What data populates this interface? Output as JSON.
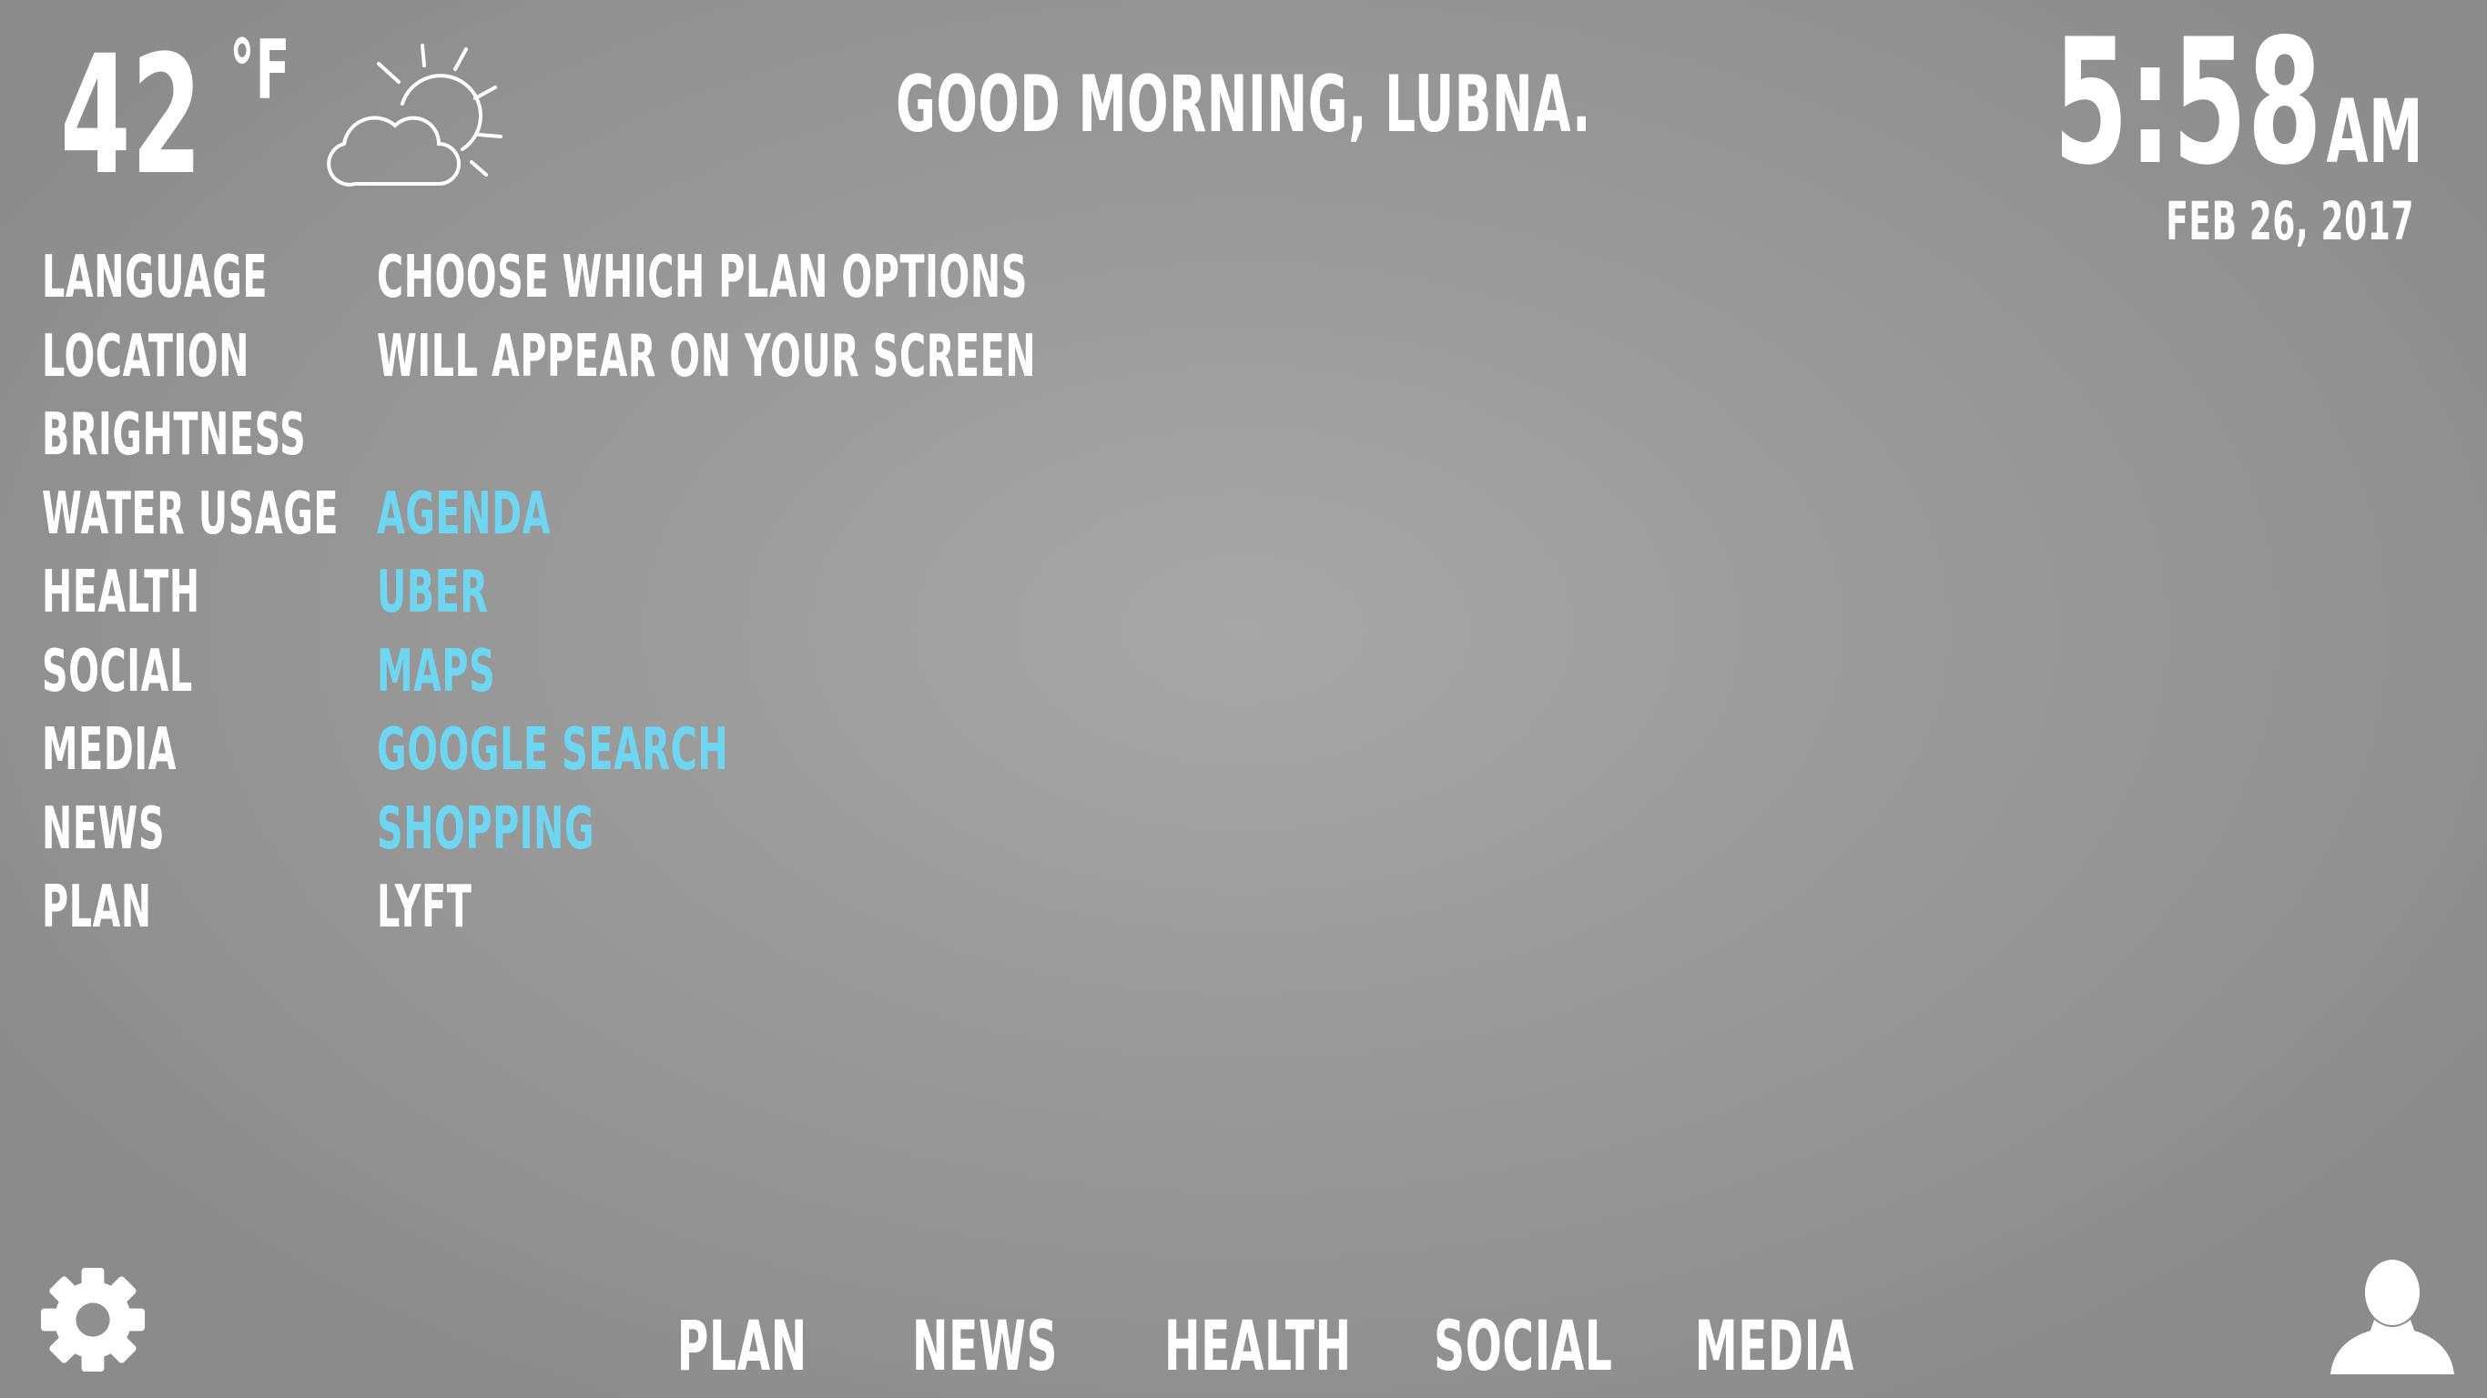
{
  "weather": {
    "temperature": "42",
    "unit": "°F",
    "icon": "partly-cloudy-icon"
  },
  "greeting": "GOOD MORNING, LUBNA.",
  "clock": {
    "time": "5:58",
    "ampm": "AM",
    "date": "FEB 26, 2017"
  },
  "settings_menu": {
    "items": [
      {
        "label": "LANGUAGE"
      },
      {
        "label": "LOCATION"
      },
      {
        "label": "BRIGHTNESS"
      },
      {
        "label": "WATER USAGE"
      },
      {
        "label": "HEALTH"
      },
      {
        "label": "SOCIAL"
      },
      {
        "label": "MEDIA"
      },
      {
        "label": "NEWS"
      },
      {
        "label": "PLAN"
      }
    ]
  },
  "plan_options": {
    "description": [
      "CHOOSE WHICH PLAN OPTIONS",
      "WILL APPEAR ON YOUR SCREEN"
    ],
    "options": [
      {
        "label": "AGENDA",
        "selected": true
      },
      {
        "label": "UBER",
        "selected": true
      },
      {
        "label": "MAPS",
        "selected": true
      },
      {
        "label": "GOOGLE SEARCH",
        "selected": true
      },
      {
        "label": "SHOPPING",
        "selected": true
      },
      {
        "label": "LYFT",
        "selected": false
      }
    ]
  },
  "bottom_nav": {
    "items": [
      {
        "label": "PLAN"
      },
      {
        "label": "NEWS"
      },
      {
        "label": "HEALTH"
      },
      {
        "label": "SOCIAL"
      },
      {
        "label": "MEDIA"
      }
    ]
  },
  "colors": {
    "text": "#ffffff",
    "selected_option": "#6fd6f2",
    "background": "#9a9a9a"
  },
  "icons": {
    "settings": "gear-icon",
    "profile": "user-icon"
  }
}
